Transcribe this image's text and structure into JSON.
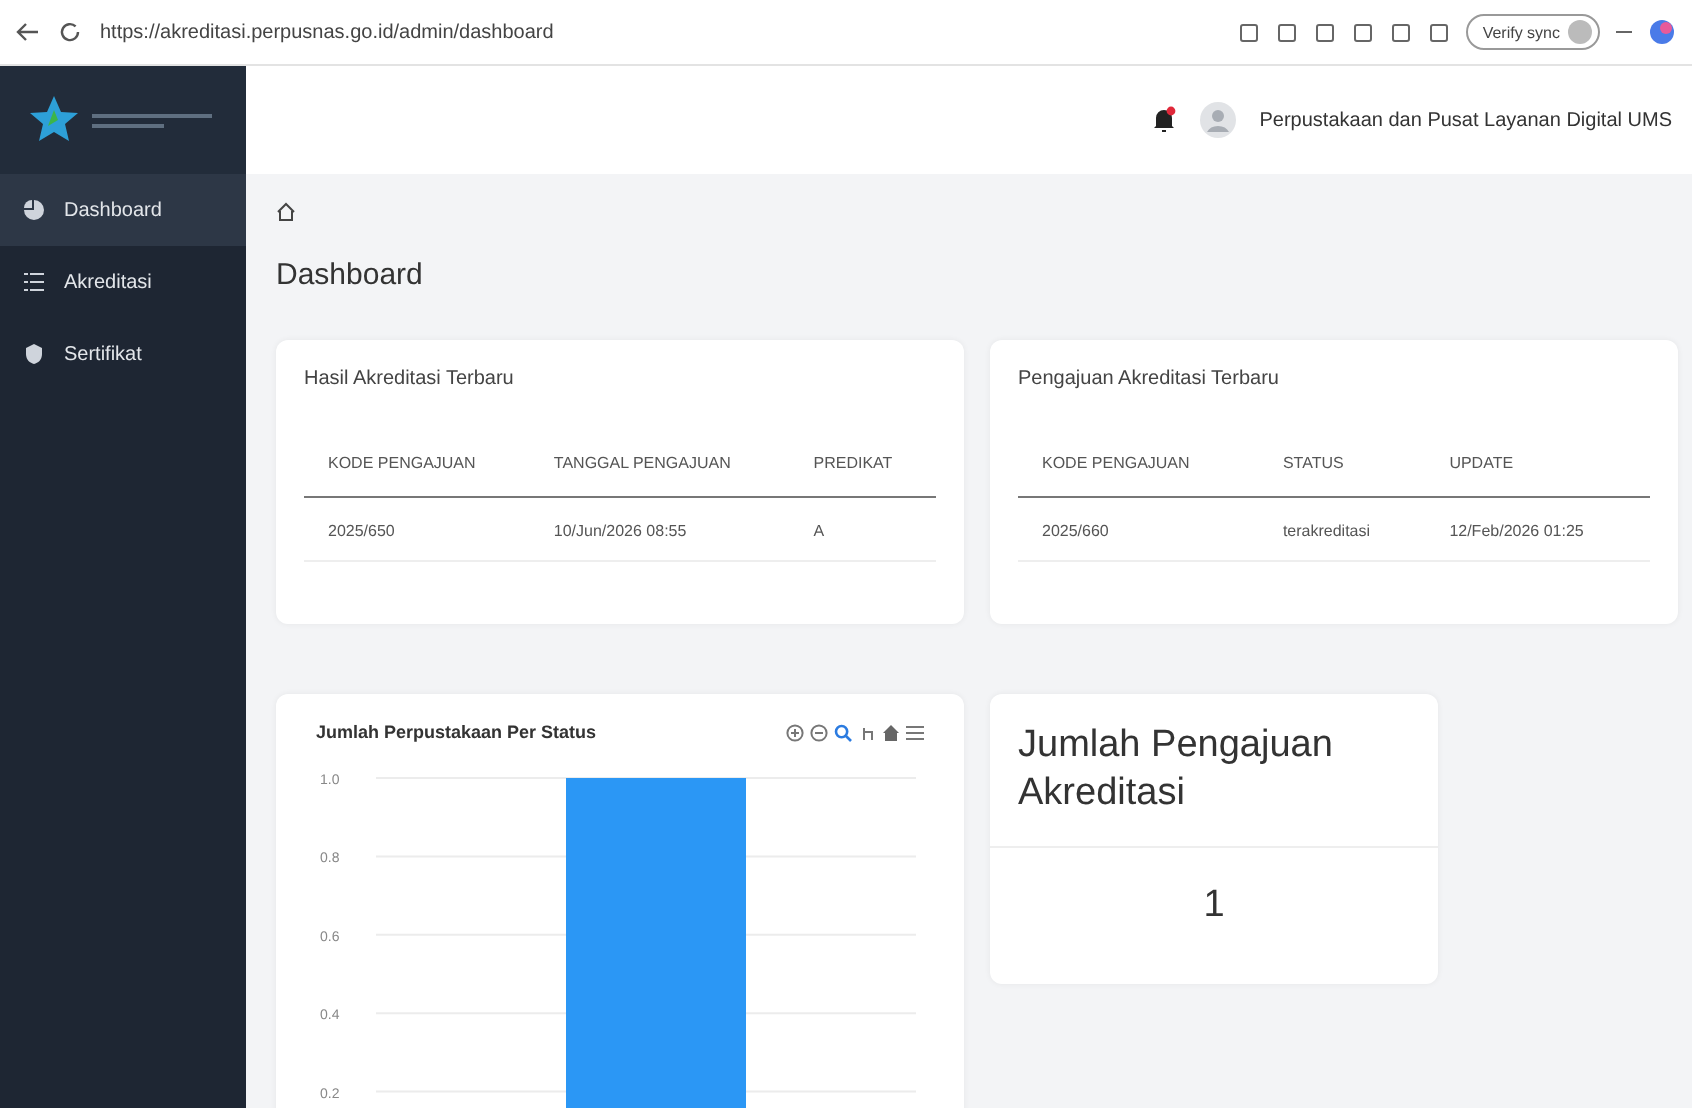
{
  "browser": {
    "url": "https://akreditasi.perpusnas.go.id/admin/dashboard",
    "profile": "Verify sync"
  },
  "sidebar": {
    "items": [
      {
        "label": "Dashboard",
        "selected": true
      },
      {
        "label": "Akreditasi",
        "selected": false
      },
      {
        "label": "Sertifikat",
        "selected": false
      }
    ]
  },
  "header": {
    "notification": true,
    "user": "Perpustakaan dan Pusat Layanan Digital UMS"
  },
  "page_title": "Dashboard",
  "cards": [
    {
      "title": "Hasil Akreditasi Terbaru",
      "columns": [
        "KODE PENGAJUAN",
        "TANGGAL PENGAJUAN",
        "PREDIKAT"
      ],
      "rows": [
        [
          "2025/650",
          "10/Jun/2026 08:55",
          "A"
        ]
      ]
    },
    {
      "title": "Pengajuan Akreditasi Terbaru",
      "columns": [
        "KODE PENGAJUAN",
        "STATUS",
        "UPDATE"
      ],
      "rows": [
        [
          "2025/660",
          "terakreditasi",
          "12/Feb/2026 01:25"
        ]
      ]
    }
  ],
  "chart": {
    "chart_data": {
      "type": "bar",
      "title": "Jumlah Perpustakaan Per Status",
      "values": [
        1
      ],
      "grid": true,
      "ylim": [
        0,
        1
      ],
      "yticks": [
        {
          "value": 1,
          "label": "1.0"
        },
        {
          "value": 0.8,
          "label": "0.8"
        },
        {
          "value": 0.6,
          "label": "0.6"
        },
        {
          "value": 0.4,
          "label": "0.4"
        },
        {
          "value": 0.2,
          "label": "0.2"
        }
      ]
    }
  },
  "count_card": {
    "title": "Jumlah Pengajuan Akreditasi",
    "value": "1"
  }
}
